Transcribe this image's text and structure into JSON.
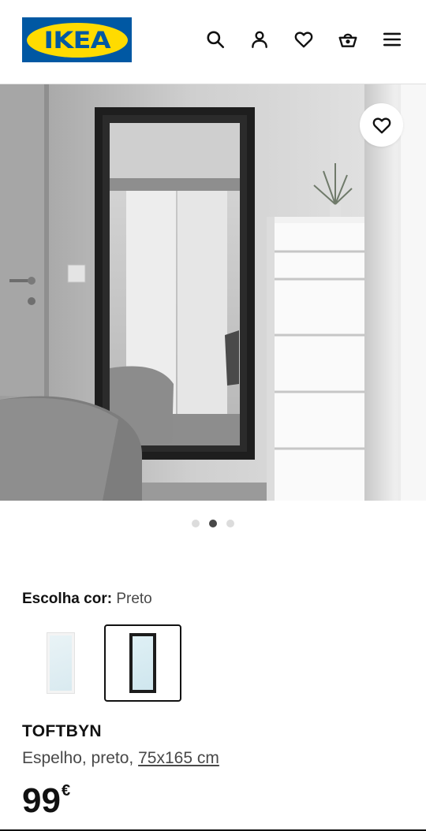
{
  "header": {
    "logo_text": "IKEA",
    "icons": [
      "search-icon",
      "user-icon",
      "heart-icon",
      "basket-icon",
      "menu-icon"
    ]
  },
  "hero": {
    "favourite_icon": "heart-icon",
    "carousel": {
      "total": 3,
      "active_index": 1
    }
  },
  "color_choice": {
    "label": "Escolha cor:",
    "value": "Preto",
    "options": [
      "white-mirror",
      "black-mirror"
    ],
    "selected_index": 1
  },
  "product": {
    "name": "TOFTBYN",
    "description": "Espelho, preto,",
    "size": "75x165 cm",
    "price": "99",
    "currency": "€"
  },
  "colors": {
    "brand_blue": "#0058a3",
    "brand_yellow": "#ffdb00",
    "text": "#111111",
    "muted": "#484848"
  }
}
